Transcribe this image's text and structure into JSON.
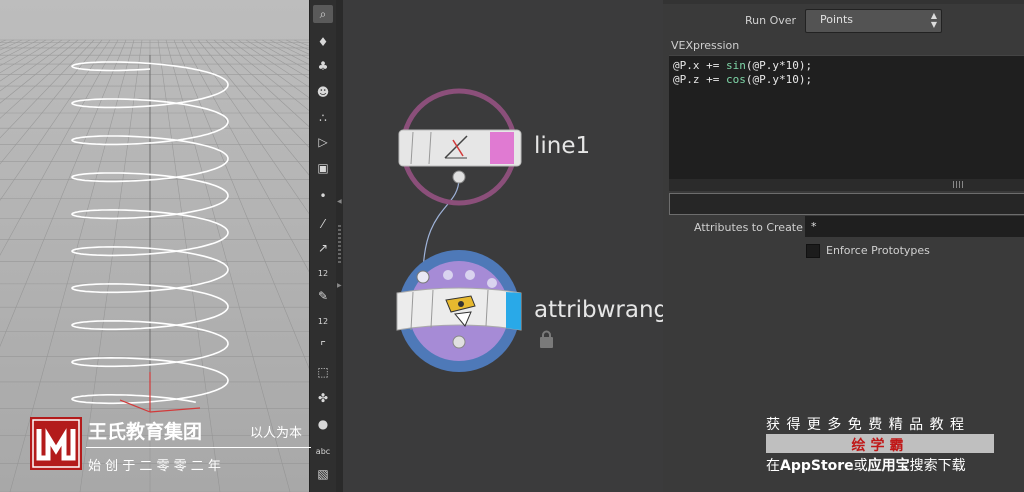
{
  "toolbar": {
    "icons": [
      {
        "name": "magnifier-icon",
        "glyph": "⌕",
        "selected": true
      },
      {
        "name": "light-icon",
        "glyph": "♦"
      },
      {
        "name": "spot-light-icon",
        "glyph": "♣"
      },
      {
        "name": "skull-icon",
        "glyph": "☻"
      },
      {
        "name": "three-spheres-icon",
        "glyph": "∴"
      },
      {
        "name": "eye-cone-icon",
        "glyph": "▷"
      },
      {
        "name": "camera-icon",
        "glyph": "▣"
      },
      {
        "name": "point-icon",
        "glyph": "•"
      },
      {
        "name": "brush-icon",
        "glyph": "⁄"
      },
      {
        "name": "pin-icon",
        "glyph": "↗"
      },
      {
        "name": "number-tool-icon",
        "glyph": "·"
      },
      {
        "name": "paint-icon",
        "glyph": "✎"
      },
      {
        "name": "numbered-paint-icon",
        "glyph": "✎"
      },
      {
        "name": "angle-icon",
        "glyph": "⌜"
      },
      {
        "name": "transform-box-icon",
        "glyph": "⬚"
      },
      {
        "name": "move-icon",
        "glyph": "✤"
      },
      {
        "name": "circle-icon",
        "glyph": "●"
      },
      {
        "name": "text-tool-icon",
        "glyph": "abc"
      },
      {
        "name": "image-icon",
        "glyph": "▧"
      }
    ],
    "badge_12a": "12",
    "badge_12b": "12",
    "text_tool": "abc"
  },
  "network": {
    "nodes": [
      {
        "label": "line1"
      },
      {
        "label": "attribwrang"
      }
    ]
  },
  "params": {
    "run_over_label": "Run Over",
    "run_over_value": "Points",
    "vex_label": "VEXpression",
    "code": [
      {
        "a": "@P.x += ",
        "fn": "sin",
        "b": "(@P.y*10);"
      },
      {
        "a": "@P.z += ",
        "fn": "cos",
        "b": "(@P.y*10);"
      }
    ],
    "attributes_label": "Attributes to Create",
    "attributes_value": "*",
    "enforce_label": "Enforce Prototypes"
  },
  "watermark": {
    "company": "王氏教育集团",
    "slogan": "以人为本",
    "founded": "始 创 于 二 零 零 二 年",
    "promo_top": "获 得 更 多 免 费 精 品 教 程",
    "promo_app": "绘学霸",
    "promo_bottom_prefix": "在",
    "promo_bottom_store": "AppStore",
    "promo_bottom_mid": "或",
    "promo_bottom_app": "应用宝",
    "promo_bottom_suffix": "搜索下载"
  },
  "colors": {
    "node_line_ring": "#8b4f7a",
    "node_wrangle_ring": "#4e79b8",
    "wrangle_inner": "#a68bd6",
    "line_flag": "#e07ad2",
    "wrangle_flag": "#29a9e8",
    "logo_red": "#b31b1b",
    "promo_red": "#c01818"
  }
}
